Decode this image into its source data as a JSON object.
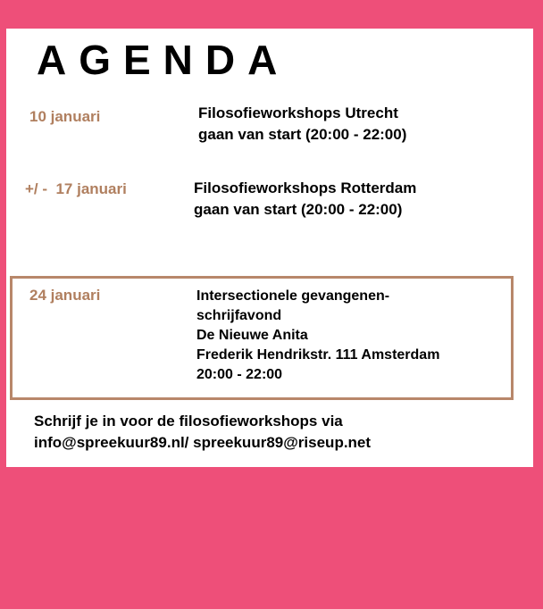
{
  "title": "AGENDA",
  "events": [
    {
      "date": "10 januari",
      "lines": [
        "Filosofieworkshops Utrecht",
        "gaan van start (20:00 - 22:00)"
      ]
    },
    {
      "date": "+/ -  17 januari",
      "lines": [
        "Filosofieworkshops Rotterdam",
        "gaan van start (20:00 - 22:00)"
      ]
    },
    {
      "date": "24 januari",
      "lines": [
        "Intersectionele gevangenen-",
        "schrijfavond",
        "De Nieuwe Anita",
        "Frederik Hendrikstr. 111 Amsterdam",
        "20:00 - 22:00"
      ]
    }
  ],
  "signup": {
    "line1": "Schrijf je in voor de filosofieworkshops via",
    "line2": "info@spreekuur89.nl/ spreekuur89@riseup.net"
  },
  "colors": {
    "background": "#ee4f79",
    "date": "#b07f5f",
    "box_border": "#b8876a"
  }
}
